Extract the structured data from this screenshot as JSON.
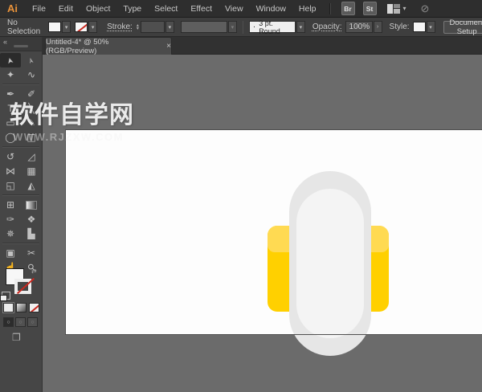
{
  "menubar": {
    "logo": "Ai",
    "menus": [
      "File",
      "Edit",
      "Object",
      "Type",
      "Select",
      "Effect",
      "View",
      "Window",
      "Help"
    ],
    "bridge_button": "Br",
    "style_button": "St"
  },
  "control_bar": {
    "selection_status": "No Selection",
    "stroke_label": "Stroke:",
    "brush_preview_dot": "·",
    "brush_value": "3 pt. Round",
    "opacity_label": "Opacity:",
    "opacity_value": "100%",
    "style_label": "Style:",
    "document_setup_label": "Document Setup"
  },
  "tab": {
    "title": "Untitled-4* @ 50% (RGB/Preview)",
    "close_glyph": "×"
  },
  "icons": {
    "chevron_down": "▾",
    "stepper_up": "▴",
    "stepper_down": "▾",
    "flyout": "›",
    "collapse": "«",
    "swap": "⇄",
    "screen_mode": "❐",
    "cs_live": "⊘",
    "draw_mode": "○"
  },
  "toolbar": {
    "tools": [
      {
        "name": "selection",
        "glyph": "➤",
        "active": true
      },
      {
        "name": "direct-selection",
        "glyph": "➢"
      },
      {
        "name": "magic-wand",
        "glyph": "✦"
      },
      {
        "name": "lasso",
        "glyph": "∿"
      },
      {
        "name": "pen",
        "glyph": "✒"
      },
      {
        "name": "paintbrush",
        "glyph": "✐"
      },
      {
        "name": "type",
        "glyph": "T"
      },
      {
        "name": "line-segment",
        "glyph": "╲"
      },
      {
        "name": "rectangle",
        "glyph": "▭"
      },
      {
        "name": "pencil",
        "glyph": "✎"
      },
      {
        "name": "ellipse",
        "glyph": "◯"
      },
      {
        "name": "eraser",
        "glyph": "◫"
      },
      {
        "name": "rotate",
        "glyph": "↺"
      },
      {
        "name": "scale",
        "glyph": "◿"
      },
      {
        "name": "width",
        "glyph": "⋈"
      },
      {
        "name": "free-transform",
        "glyph": "▦"
      },
      {
        "name": "shape-builder",
        "glyph": "◱"
      },
      {
        "name": "perspective-grid",
        "glyph": "◭"
      },
      {
        "name": "mesh",
        "glyph": "⊞"
      },
      {
        "name": "gradient",
        "glyph": ""
      },
      {
        "name": "eyedropper",
        "glyph": "✑"
      },
      {
        "name": "blend",
        "glyph": "❖"
      },
      {
        "name": "symbol-sprayer",
        "glyph": "✵"
      },
      {
        "name": "column-graph",
        "glyph": "▙"
      },
      {
        "name": "artboard",
        "glyph": "▣"
      },
      {
        "name": "slice",
        "glyph": "✂"
      },
      {
        "name": "hand",
        "glyph": "☝"
      },
      {
        "name": "zoom",
        "glyph": "⚲"
      }
    ]
  },
  "watermark": {
    "title": "软件自学网",
    "subtitle": "WWW.RJZXW.COM"
  },
  "canvas": {
    "pasteboard_color": "#6B6B6B",
    "artboard_color": "#FDFDFD",
    "shapes": {
      "yellow_rect": {
        "fill": "#FFD000",
        "band_fill": "#FFDA52"
      },
      "capsule": {
        "outer_fill": "#E6E6E6",
        "inner_fill": "#F4F4F4"
      }
    }
  }
}
